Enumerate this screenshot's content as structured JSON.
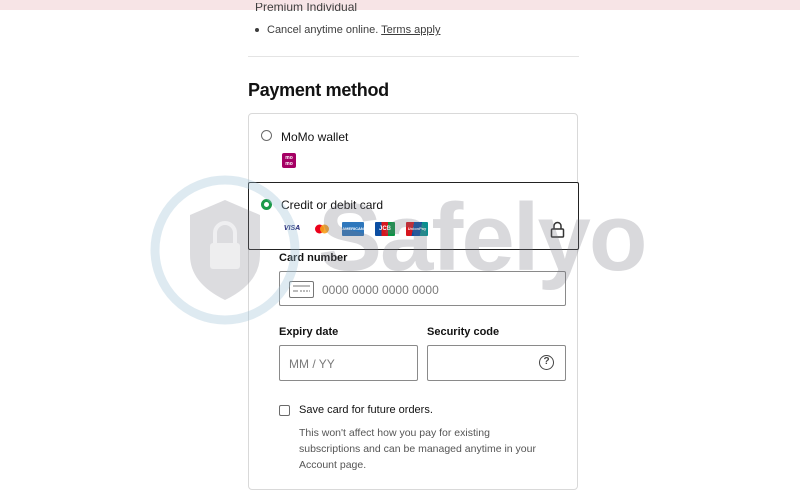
{
  "plan_list": {
    "partial_line": "Premium Individual",
    "bullet_text": "Cancel anytime online.",
    "bullet_link": "Terms apply"
  },
  "payment": {
    "title": "Payment method",
    "options": [
      {
        "label": "MoMo wallet",
        "selected": false,
        "logo": "momo-logo"
      },
      {
        "label": "Credit or debit card",
        "selected": true,
        "brands": [
          "VISA",
          "Mastercard",
          "American Express",
          "JCB",
          "UnionPay"
        ]
      }
    ],
    "brand_text": {
      "visa": "VISA",
      "amex": "AMERICAN EXPRESS",
      "jcb": "JCB",
      "unionpay": "UnionPay",
      "momo": "mo mo"
    }
  },
  "form": {
    "card_number_label": "Card number",
    "card_number_placeholder": "0000 0000 0000 0000",
    "expiry_label": "Expiry date",
    "expiry_placeholder": "MM / YY",
    "security_label": "Security code",
    "help_glyph": "?",
    "save_card_label": "Save card for future orders.",
    "save_card_help": "This won't affect how you pay for existing subscriptions and can be managed anytime in your Account page."
  },
  "watermark": {
    "text": "Safelyo"
  },
  "colors": {
    "selected_radio": "#1a9a48",
    "momo_brand": "#a50064",
    "top_bar": "#f7e4e6"
  }
}
